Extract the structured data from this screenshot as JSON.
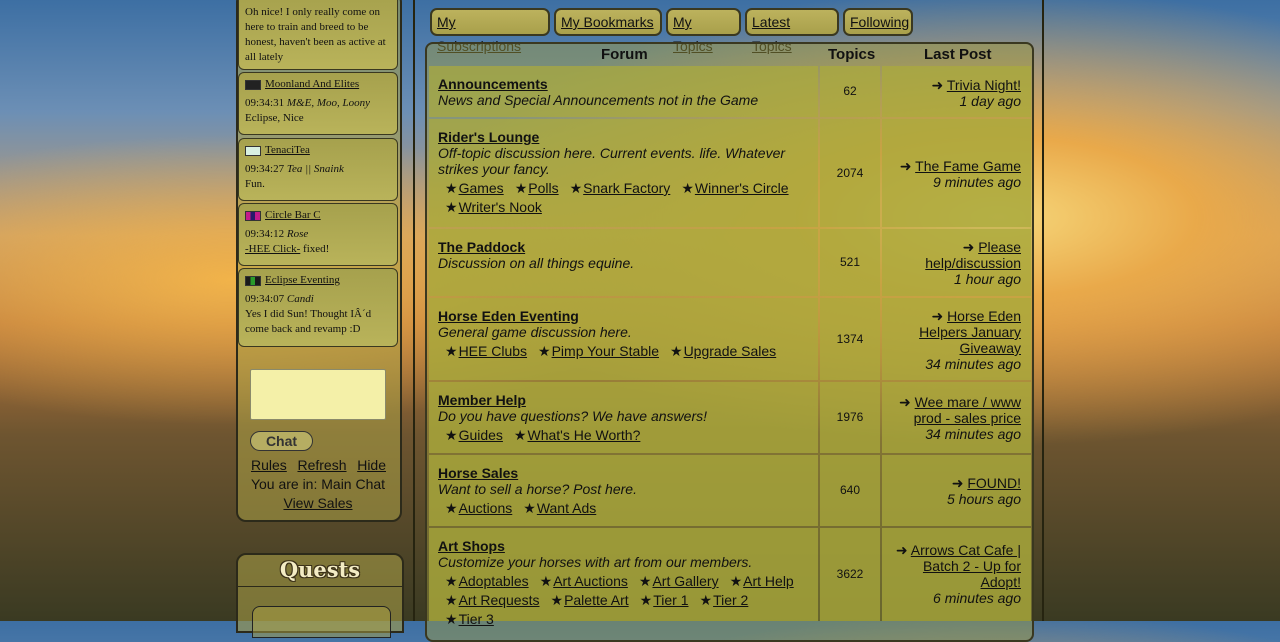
{
  "chat": {
    "first_message_text": "Oh nice! I only really come on here to train and breed to be honest, haven't been as active at all lately",
    "messages": [
      {
        "channel": "Moonland And Elites",
        "time": "09:34:31",
        "user": "M&E, Moo, Loony",
        "text": "Eclipse, Nice",
        "flag_color": "#222222"
      },
      {
        "channel": "TenaciTea",
        "time": "09:34:27",
        "user": "Tea || Snaink",
        "text": "Fun.",
        "flag_color": "#d8f0e0"
      },
      {
        "channel": "Circle Bar C",
        "time": "09:34:12",
        "user": "Rose",
        "link": "-HEE Click-",
        "text": "fixed!",
        "flag_color": "#6a1a8a"
      },
      {
        "channel": "Eclipse Eventing",
        "time": "09:34:07",
        "user": "Candi",
        "text": "Yes I did Sun! Thought IÂ´d come back and revamp :D",
        "flag_color": "#2a8a2a"
      }
    ],
    "chat_button": "Chat",
    "links": {
      "rules": "Rules",
      "refresh": "Refresh",
      "hide": "Hide"
    },
    "location": "You are in: Main Chat",
    "view_sales": "View Sales"
  },
  "quests": {
    "title": "Quests"
  },
  "nav": {
    "subscriptions": "My Subscriptions",
    "bookmarks": "My Bookmarks",
    "topics": "My Topics",
    "latest": "Latest Topics",
    "following": "Following"
  },
  "forum": {
    "headers": {
      "forum": "Forum",
      "topics": "Topics",
      "last_post": "Last Post"
    },
    "rows": [
      {
        "title": "Announcements",
        "desc": "News and Special Announcements not in the Game",
        "topics": "62",
        "last_title": "Trivia Night!",
        "last_ago": "1 day ago",
        "subs": []
      },
      {
        "title": "Rider's Lounge",
        "desc": "Off-topic discussion here. Current events. life. Whatever strikes your fancy.",
        "topics": "2074",
        "last_title": "The Fame Game",
        "last_ago": "9 minutes ago",
        "subs": [
          "Games",
          "Polls",
          "Snark Factory",
          "Winner's Circle",
          "Writer's Nook"
        ]
      },
      {
        "title": "The Paddock",
        "desc": "Discussion on all things equine.",
        "topics": "521",
        "last_title": "Please help/discussion",
        "last_ago": "1 hour ago",
        "subs": []
      },
      {
        "title": "Horse Eden Eventing",
        "desc": "General game discussion here.",
        "topics": "1374",
        "last_title": "Horse Eden Helpers January Giveaway",
        "last_ago": "34 minutes ago",
        "subs": [
          "HEE Clubs",
          "Pimp Your Stable",
          "Upgrade Sales"
        ]
      },
      {
        "title": "Member Help",
        "desc": "Do you have questions? We have answers!",
        "topics": "1976",
        "last_title": "Wee mare / www prod - sales price",
        "last_ago": "34 minutes ago",
        "subs": [
          "Guides",
          "What's He Worth?"
        ]
      },
      {
        "title": "Horse Sales",
        "desc": "Want to sell a horse? Post here.",
        "topics": "640",
        "last_title": "FOUND!",
        "last_ago": "5 hours ago",
        "subs": [
          "Auctions",
          "Want Ads"
        ]
      },
      {
        "title": "Art Shops",
        "desc": "Customize your horses with art from our members.",
        "topics": "3622",
        "last_title": "Arrows Cat Cafe | Batch 2 - Up for Adopt!",
        "last_ago": "6 minutes ago",
        "subs": [
          "Adoptables",
          "Art Auctions",
          "Art Gallery",
          "Art Help",
          "Art Requests",
          "Palette Art",
          "Tier 1",
          "Tier 2",
          "Tier 3"
        ]
      }
    ]
  }
}
